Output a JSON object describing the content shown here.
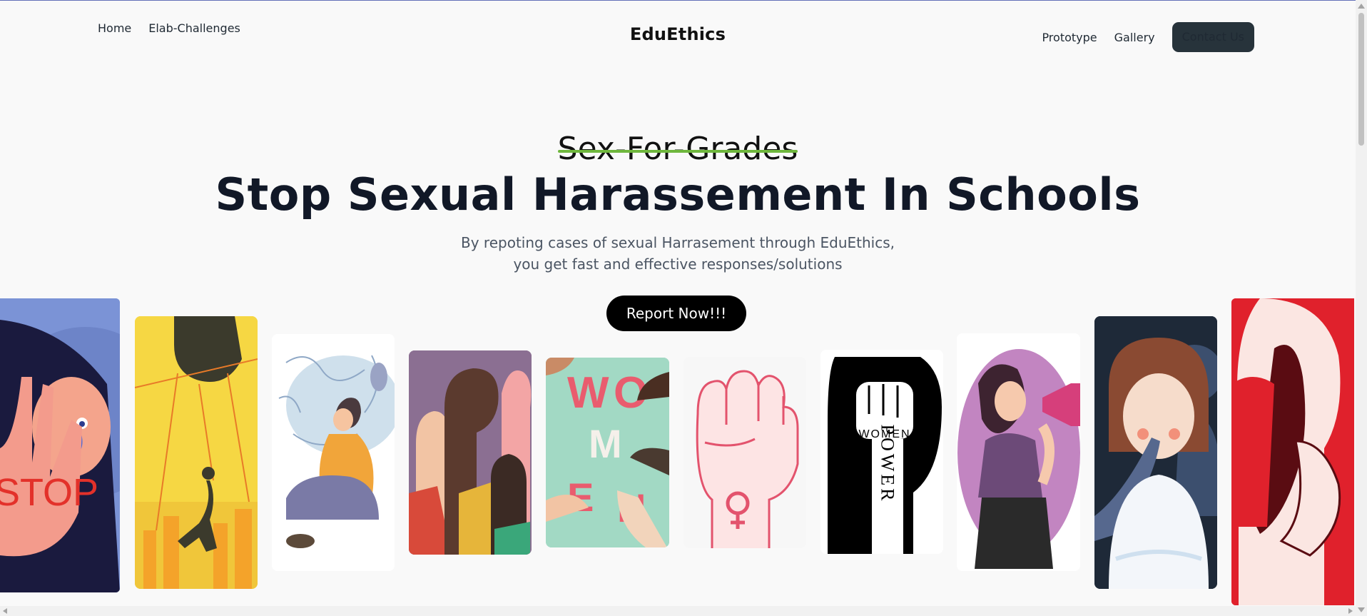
{
  "nav": {
    "home": "Home",
    "challenges": "Elab-Challenges",
    "brand": "EduEthics",
    "prototype": "Prototype",
    "gallery": "Gallery",
    "contact": "Contact Us"
  },
  "hero": {
    "struck_text": "Sex-For-Grades",
    "headline": "Stop Sexual Harassement In Schools",
    "subtitle_line1": "By repoting cases of sexual Harrasement through EduEthics,",
    "subtitle_line2": "you get fast and effective responses/solutions",
    "cta": "Report Now!!!"
  },
  "gallery": {
    "stop_text": "STOP",
    "women_text": "WOMEN",
    "power_text": "POWER",
    "women_letters": [
      "W",
      "O",
      "M",
      "E",
      "N"
    ]
  },
  "colors": {
    "accent_green": "#6fb73d",
    "button_dark": "#27333b",
    "cta_black": "#000000"
  }
}
